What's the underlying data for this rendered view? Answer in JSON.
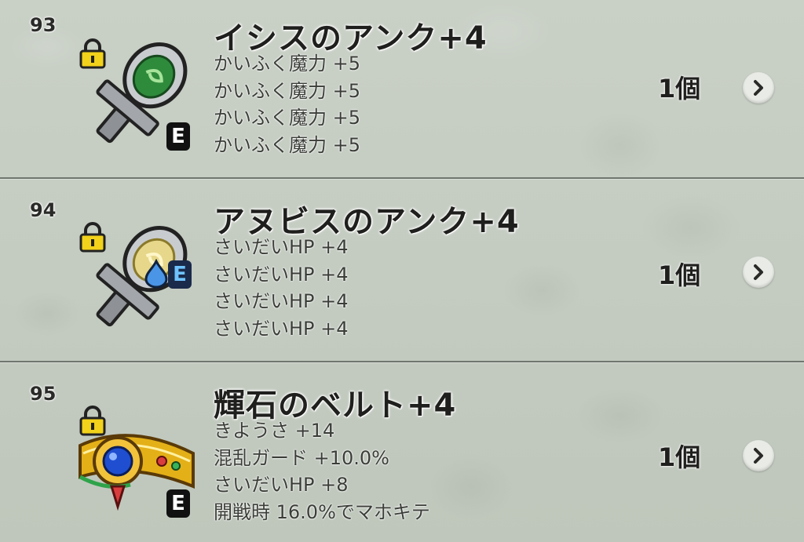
{
  "items": [
    {
      "number": "93",
      "name": "イシスのアンク+4",
      "stats": [
        "かいふく魔力 +5",
        "かいふく魔力 +5",
        "かいふく魔力 +5",
        "かいふく魔力 +5"
      ],
      "quantity": "1個",
      "equip_badge": "E",
      "icon": "isis-ankh-icon",
      "locked": true
    },
    {
      "number": "94",
      "name": "アヌビスのアンク+4",
      "stats": [
        "さいだいHP +4",
        "さいだいHP +4",
        "さいだいHP +4",
        "さいだいHP +4"
      ],
      "quantity": "1個",
      "equip_badge": "E",
      "icon": "anubis-ankh-icon",
      "locked": true
    },
    {
      "number": "95",
      "name": "輝石のベルト+4",
      "stats": [
        "きようさ +14",
        "混乱ガード +10.0%",
        "さいだいHP +8",
        "開戦時 16.0%でマホキテ"
      ],
      "quantity": "1個",
      "equip_badge": "E",
      "icon": "kiseki-belt-icon",
      "locked": true
    }
  ],
  "colors": {
    "background": "#c5ccc2",
    "lock": "#f2d21a",
    "equip_badge_blue": "#6ec3ff",
    "text_dark": "#1f1f1d"
  }
}
